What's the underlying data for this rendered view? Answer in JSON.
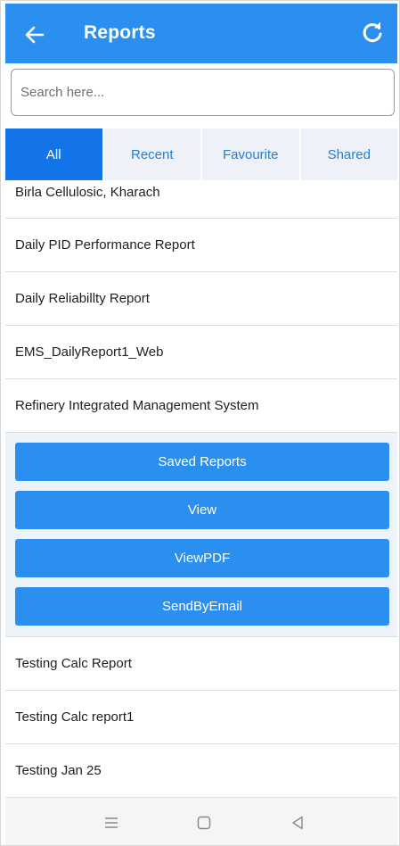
{
  "app_bar": {
    "title": "Reports",
    "back_icon": "arrow-left-icon",
    "refresh_icon": "refresh-icon",
    "color": "#2b8ff0"
  },
  "search": {
    "placeholder": "Search here...",
    "value": ""
  },
  "tabs": [
    {
      "label": "All",
      "active": true
    },
    {
      "label": "Recent",
      "active": false
    },
    {
      "label": "Favourite",
      "active": false
    },
    {
      "label": "Shared",
      "active": false
    }
  ],
  "reports_before": [
    "Birla Cellulosic, Kharach",
    "Daily PID Performance Report",
    "Daily Reliabillty Report",
    "EMS_DailyReport1_Web",
    "Refinery Integrated Management System"
  ],
  "actions": [
    "Saved Reports",
    "View",
    "ViewPDF",
    "SendByEmail"
  ],
  "reports_after": [
    "Testing Calc Report",
    "Testing Calc report1",
    "Testing Jan 25"
  ],
  "nav_bar": {
    "icons": [
      "menu-icon",
      "home-square-icon",
      "back-triangle-icon"
    ]
  }
}
